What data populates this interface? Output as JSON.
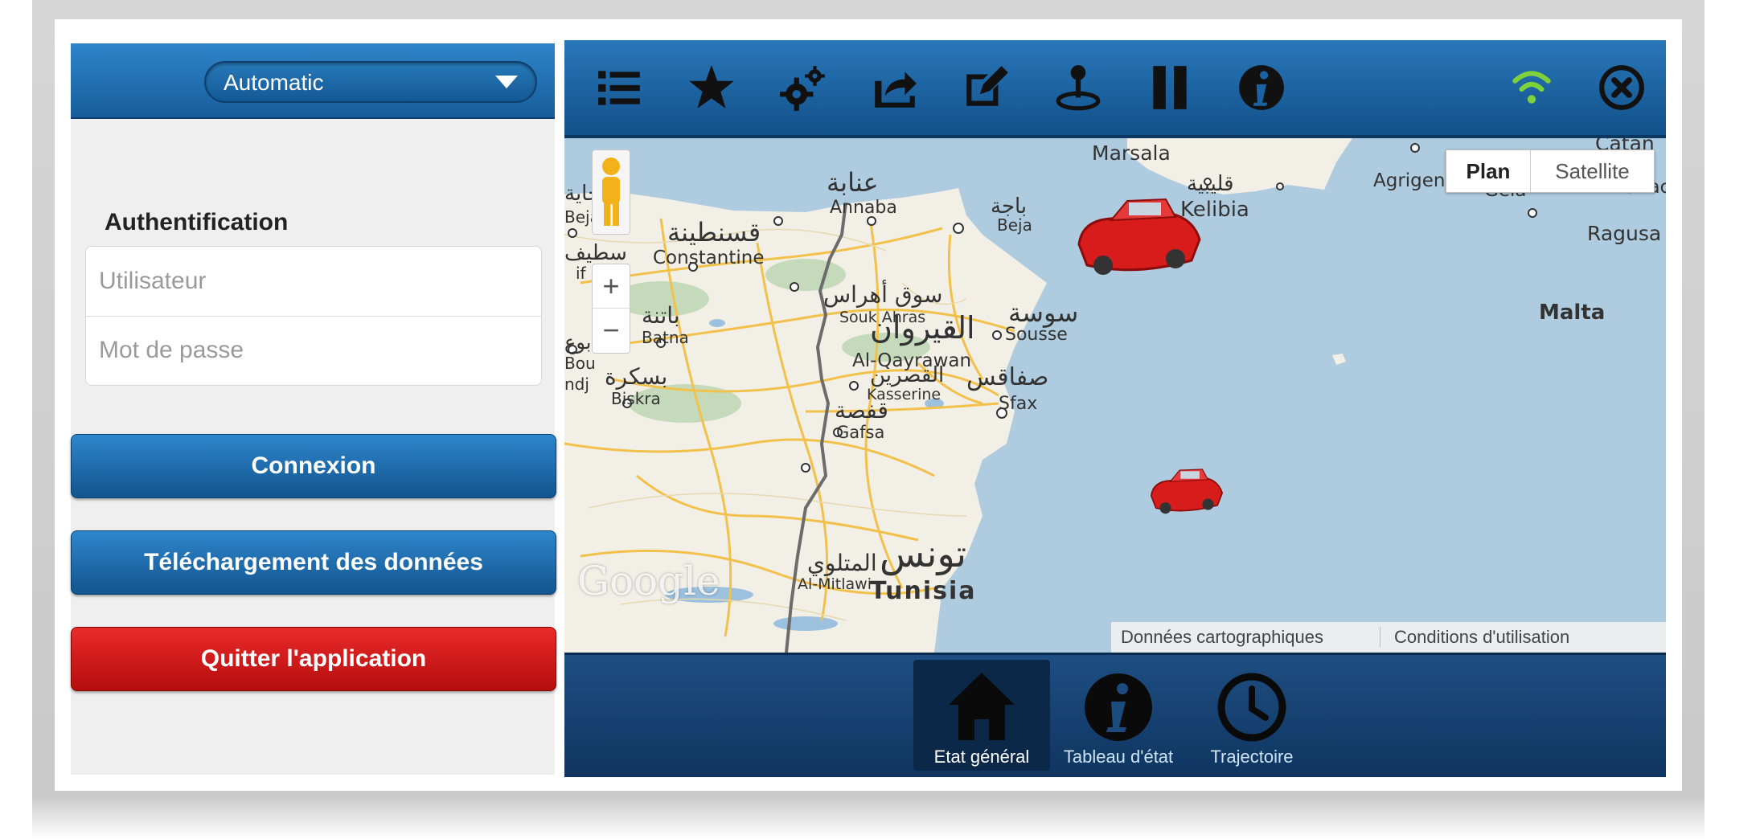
{
  "left_panel": {
    "mode_select": {
      "value": "Automatic"
    },
    "auth_title": "Authentification",
    "username_placeholder": "Utilisateur",
    "password_placeholder": "Mot de passe",
    "buttons": {
      "connect": "Connexion",
      "download": "Téléchargement des données",
      "quit": "Quitter l'application"
    }
  },
  "toolbar": {
    "icons": [
      "list-icon",
      "star-icon",
      "gears-icon",
      "share-icon",
      "edit-icon",
      "joystick-icon",
      "pause-icon",
      "info-icon",
      "wifi-icon",
      "close-icon"
    ],
    "colors": {
      "wifi": "#7ed13b",
      "bar": "#1b62a3"
    }
  },
  "map": {
    "type_buttons": {
      "plan": "Plan",
      "satellite": "Satellite"
    },
    "zoom_in": "+",
    "zoom_out": "−",
    "labels": {
      "marsala": "Marsala",
      "catania": "Catan",
      "agrigento": "Agrigento",
      "gela": "Gela",
      "siracusa": "Sirac",
      "ragusa": "Ragusa",
      "malta": "Malta",
      "annaba_ar": "عنابة",
      "annaba": "Annaba",
      "beja_ar": "باجة",
      "beja": "Beja",
      "kelibia_ar": "قليبية",
      "kelibia": "Kelibia",
      "bejaia_ar": "بجاية",
      "bejaia": "Bejaia",
      "constantine_ar": "قسنطينة",
      "constantine": "Constantine",
      "souk_ahras_ar": "سوق أهراس",
      "souk_ahras": "Souk Ahras",
      "batna_ar": "باتنة",
      "batna": "Batna",
      "kairouan_ar": "القيروان",
      "kairouan": "Al-Qayrawan",
      "sousse_ar": "سوسة",
      "sousse": "Sousse",
      "kasserine_ar": "القصرين",
      "kasserine": "Kasserine",
      "biskra_ar": "بسكرة",
      "biskra": "Biskra",
      "gafsa_ar": "قفصة",
      "gafsa": "Gafsa",
      "sfax_ar": "صفاقس",
      "sfax": "Sfax",
      "mitlawi_ar": "المتلوي",
      "mitlawi": "Al-Mitlawi",
      "tunisia_ar": "تونس",
      "tunisia": "Tunisia",
      "setif_fragment": "سطيف",
      "setif_fragment_latin": "if",
      "bou_ar": "بوع",
      "bou": "Bou",
      "ndj": "ndj"
    },
    "google_logo": "Google",
    "attribution": {
      "data": "Données cartographiques",
      "terms": "Conditions d'utilisation"
    },
    "colors": {
      "sea": "#aecbdf",
      "land": "#f2efe6",
      "roads": "#f2c14b",
      "border": "#707070",
      "car": "#d81c1c"
    }
  },
  "bottom_nav": {
    "items": [
      {
        "label": "Etat général",
        "icon": "home-icon"
      },
      {
        "label": "Tableau d'état",
        "icon": "info-circle-icon"
      },
      {
        "label": "Trajectoire",
        "icon": "clock-icon"
      }
    ]
  }
}
